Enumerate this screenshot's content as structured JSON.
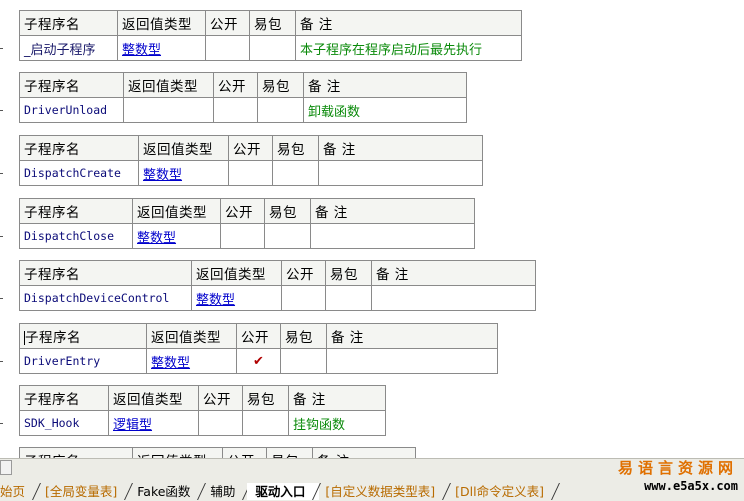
{
  "headers": {
    "name": "子程序名",
    "return_type": "返回值类型",
    "public": "公开",
    "easy_pack": "易包",
    "note": "备 注"
  },
  "subroutines": [
    {
      "name": "_启动子程序",
      "return_type": "整数型",
      "public": "",
      "easy_pack": "",
      "note": "本子程序在程序启动后最先执行"
    },
    {
      "name": "DriverUnload",
      "return_type": "",
      "public": "",
      "easy_pack": "",
      "note": "卸载函数"
    },
    {
      "name": "DispatchCreate",
      "return_type": "整数型",
      "public": "",
      "easy_pack": "",
      "note": ""
    },
    {
      "name": "DispatchClose",
      "return_type": "整数型",
      "public": "",
      "easy_pack": "",
      "note": ""
    },
    {
      "name": "DispatchDeviceControl",
      "return_type": "整数型",
      "public": "",
      "easy_pack": "",
      "note": ""
    },
    {
      "name": "DriverEntry",
      "return_type": "整数型",
      "public": "✔",
      "easy_pack": "",
      "note": ""
    },
    {
      "name": "SDK_Hook",
      "return_type": "逻辑型",
      "public": "",
      "easy_pack": "",
      "note": "挂钩函数"
    }
  ],
  "tabs": [
    {
      "label": "始页",
      "state": "link"
    },
    {
      "label": "[全局变量表]",
      "state": "link"
    },
    {
      "label": "Fake函数",
      "state": "normal"
    },
    {
      "label": "辅助",
      "state": "normal"
    },
    {
      "label": "驱动入口",
      "state": "active"
    },
    {
      "label": "[自定义数据类型表]",
      "state": "link"
    },
    {
      "label": "[Dll命令定义表]",
      "state": "link"
    }
  ],
  "watermark": {
    "site": "易语言资源网",
    "url": "www.e5a5x.com"
  }
}
